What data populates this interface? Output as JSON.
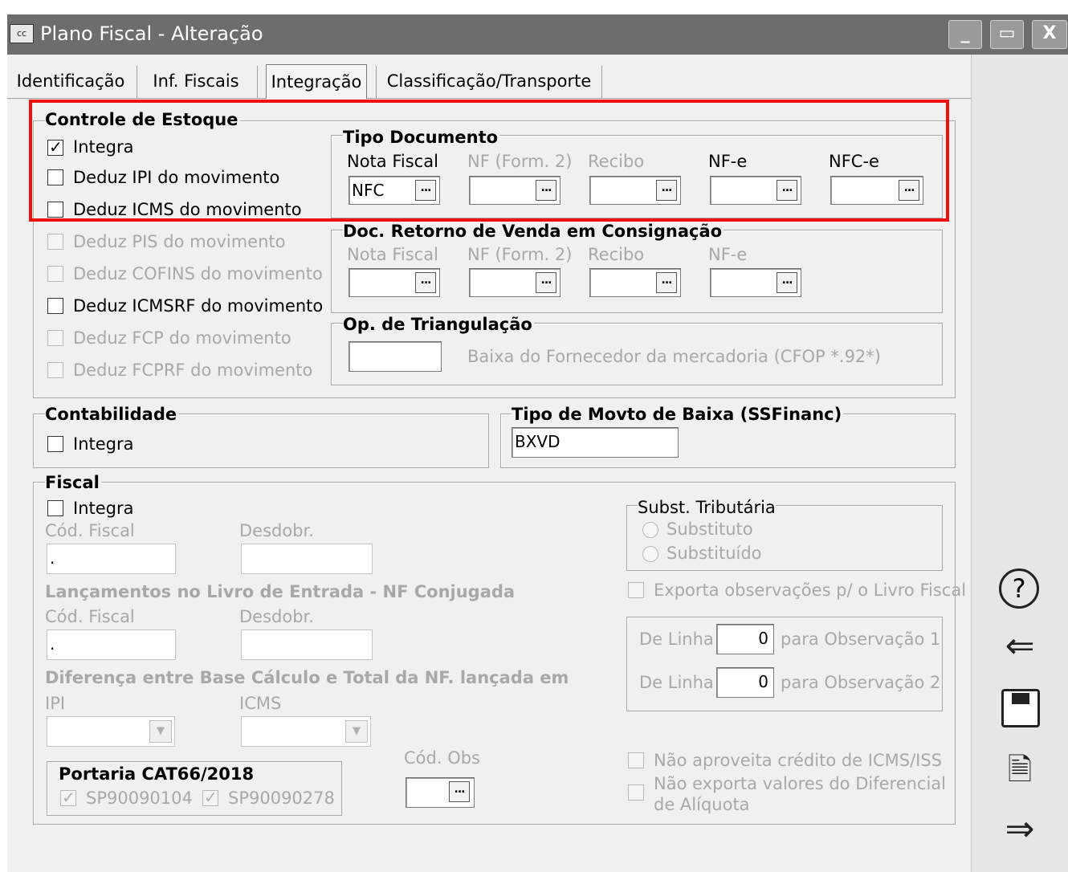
{
  "window": {
    "title": "Plano Fiscal - Alteração",
    "app_icon_text": "cc",
    "minimize_glyph": "_",
    "maximize_glyph": "▭",
    "close_glyph": "X"
  },
  "tabs": [
    {
      "label": "Identificação"
    },
    {
      "label": "Inf. Fiscais"
    },
    {
      "label": "Integração",
      "selected": true
    },
    {
      "label": "Classificação/Transporte"
    }
  ],
  "controle_estoque": {
    "title": "Controle de Estoque",
    "checkboxes": [
      {
        "label": "Integra",
        "checked": true,
        "enabled": true
      },
      {
        "label": "Deduz IPI do movimento",
        "checked": false,
        "enabled": true
      },
      {
        "label": "Deduz ICMS do movimento",
        "checked": false,
        "enabled": true
      },
      {
        "label": "Deduz PIS do movimento",
        "checked": false,
        "enabled": false
      },
      {
        "label": "Deduz COFINS do movimento",
        "checked": false,
        "enabled": false
      },
      {
        "label": "Deduz ICMSRF do movimento",
        "checked": false,
        "enabled": true
      },
      {
        "label": "Deduz FCP do movimento",
        "checked": false,
        "enabled": false
      },
      {
        "label": "Deduz FCPRF do movimento",
        "checked": false,
        "enabled": false
      }
    ]
  },
  "tipo_documento": {
    "title": "Tipo Documento",
    "fields": [
      {
        "label": "Nota Fiscal",
        "value": "NFC",
        "enabled": true
      },
      {
        "label": "NF (Form. 2)",
        "value": "",
        "enabled": false
      },
      {
        "label": "Recibo",
        "value": "",
        "enabled": false
      },
      {
        "label": "NF-e",
        "value": "",
        "enabled": true
      },
      {
        "label": "NFC-e",
        "value": "",
        "enabled": true
      }
    ],
    "button_glyph": "..."
  },
  "doc_retorno": {
    "title": "Doc. Retorno de Venda em Consignação",
    "fields": [
      {
        "label": "Nota Fiscal",
        "value": ""
      },
      {
        "label": "NF (Form. 2)",
        "value": ""
      },
      {
        "label": "Recibo",
        "value": ""
      },
      {
        "label": "NF-e",
        "value": ""
      }
    ]
  },
  "triangulacao": {
    "title": "Op. de Triangulação",
    "value": "",
    "description": "Baixa do Fornecedor da mercadoria (CFOP *.92*)"
  },
  "contabilidade": {
    "title": "Contabilidade",
    "integra_label": "Integra",
    "integra_checked": false
  },
  "tipo_movto": {
    "title": "Tipo de Movto de Baixa (SSFinanc)",
    "value": "BXVD"
  },
  "fiscal": {
    "title": "Fiscal",
    "integra_label": "Integra",
    "integra_checked": false,
    "cod_fiscal_label": "Cód. Fiscal",
    "cod_fiscal_value": ".",
    "desdobr_label": "Desdobr.",
    "desdobr_value": "",
    "lancamentos_title": "Lançamentos no Livro de Entrada - NF Conjugada",
    "lanc_cod_fiscal_label": "Cód. Fiscal",
    "lanc_cod_fiscal_value": ".",
    "lanc_desdobr_label": "Desdobr.",
    "lanc_desdobr_value": "",
    "diferenca_title": "Diferença entre Base Cálculo e Total da NF. lançada em",
    "ipi_label": "IPI",
    "ipi_value": "",
    "icms_label": "ICMS",
    "icms_value": "",
    "portaria_title": "Portaria CAT66/2018",
    "portaria_options": [
      {
        "label": "SP90090104",
        "checked": true
      },
      {
        "label": "SP90090278",
        "checked": true
      }
    ],
    "cod_obs_label": "Cód. Obs",
    "cod_obs_value": "",
    "subst_title": "Subst. Tributária",
    "subst_options": [
      {
        "label": "Substituto"
      },
      {
        "label": "Substituído"
      }
    ],
    "exporta_obs_label": "Exporta observações p/ o Livro Fiscal",
    "linhas": [
      {
        "label": "De Linha",
        "value": "0",
        "suffix": "para Observação 1"
      },
      {
        "label": "De Linha",
        "value": "0",
        "suffix": "para Observação 2"
      }
    ],
    "nao_aproveita_label": "Não aproveita crédito de ICMS/ISS",
    "nao_exporta_line1": "Não exporta valores do Diferencial",
    "nao_exporta_line2": "de Alíquota"
  },
  "side_actions": [
    {
      "name": "help-icon",
      "glyph": "?"
    },
    {
      "name": "back-arrow-icon",
      "glyph": "⇐"
    },
    {
      "name": "save-icon",
      "glyph": "💾"
    },
    {
      "name": "cancel-document-icon",
      "glyph": "🗎"
    },
    {
      "name": "forward-arrow-icon",
      "glyph": "⇒"
    }
  ],
  "colors": {
    "titlebar": "#6d6d6d",
    "highlight_box": "#ee1111",
    "disabled_text": "#a8a8a8"
  }
}
